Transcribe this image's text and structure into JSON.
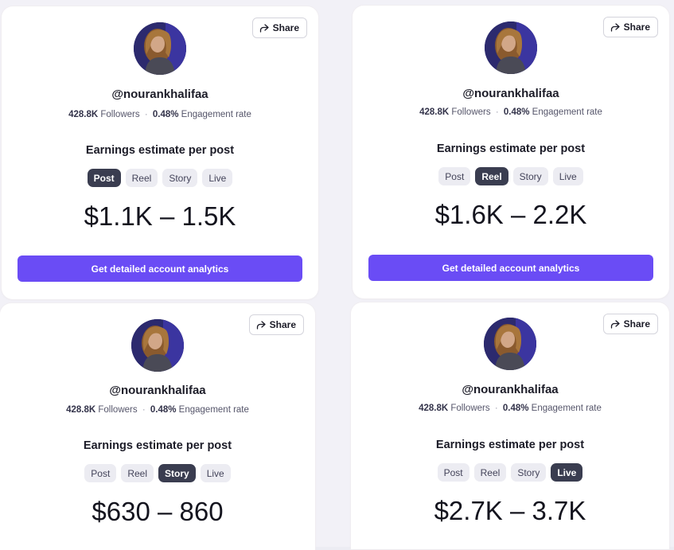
{
  "share_label": "Share",
  "profile": {
    "username": "@nourankhalifaa",
    "followers_value": "428.8K",
    "followers_label": "Followers",
    "separator": "·",
    "engagement_value": "0.48%",
    "engagement_label": "Engagement rate"
  },
  "estimate_title": "Earnings estimate per post",
  "tabs": [
    "Post",
    "Reel",
    "Story",
    "Live"
  ],
  "cta_label": "Get detailed account analytics",
  "cards": [
    {
      "active_tab": "Post",
      "range": "$1.1K – 1.5K",
      "show_cta": true
    },
    {
      "active_tab": "Reel",
      "range": "$1.6K – 2.2K",
      "show_cta": true
    },
    {
      "active_tab": "Story",
      "range": "$630 – 860",
      "show_cta": false
    },
    {
      "active_tab": "Live",
      "range": "$2.7K – 3.7K",
      "show_cta": false
    }
  ],
  "colors": {
    "accent": "#6a4cf5",
    "active_tab": "#3a3d50",
    "tab_bg": "#ececf2"
  },
  "icons": {
    "share": "share-arrow-icon",
    "avatar": "profile-photo"
  }
}
